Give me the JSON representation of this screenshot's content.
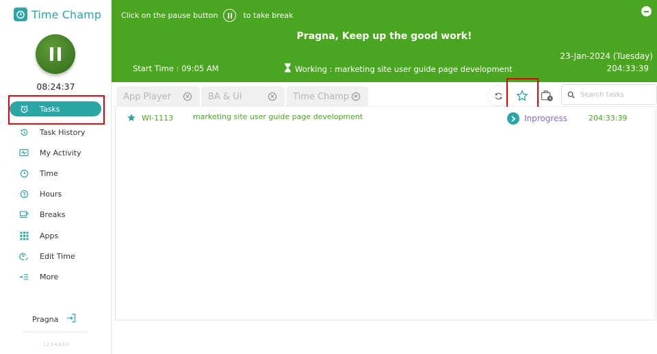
{
  "app": {
    "name": "Time Champ",
    "timer": "08:24:37",
    "version": "1.2.3.4.9.5.0"
  },
  "sidebar": {
    "items": [
      {
        "label": "Tasks",
        "icon": "alarm-clock-icon",
        "active": true
      },
      {
        "label": "Task History",
        "icon": "history-icon"
      },
      {
        "label": "My Activity",
        "icon": "activity-icon"
      },
      {
        "label": "Time",
        "icon": "clock-icon"
      },
      {
        "label": "Hours",
        "icon": "hours-icon"
      },
      {
        "label": "Breaks",
        "icon": "coffee-cup-icon"
      },
      {
        "label": "Apps",
        "icon": "grid-apps-icon"
      },
      {
        "label": "Edit Time",
        "icon": "edit-time-icon"
      },
      {
        "label": "More",
        "icon": "more-list-icon"
      }
    ],
    "user": "Pragna"
  },
  "header": {
    "break_hint_prefix": "Click on the pause button",
    "break_hint_suffix": "to take break",
    "greeting": "Pragna, Keep up the good work!",
    "date": "23-Jan-2024 (Tuesday)",
    "total_time": "204:33:39",
    "start_time": "Start Time : 09:05 AM",
    "working": "Working : marketing site user guide page development"
  },
  "tabs": [
    {
      "label": "App Player"
    },
    {
      "label": "BA & UI"
    },
    {
      "label": "Time Champ"
    }
  ],
  "search": {
    "placeholder": "Search tasks"
  },
  "tasks": [
    {
      "id": "WI-1113",
      "name": "marketing site user guide page development",
      "status": "Inprogress",
      "duration": "204:33:39"
    }
  ],
  "colors": {
    "brand": "#2ba6a6",
    "header_bg": "#4aa520",
    "status_text": "#8a6ccd",
    "highlight_box": "#e3000f"
  }
}
